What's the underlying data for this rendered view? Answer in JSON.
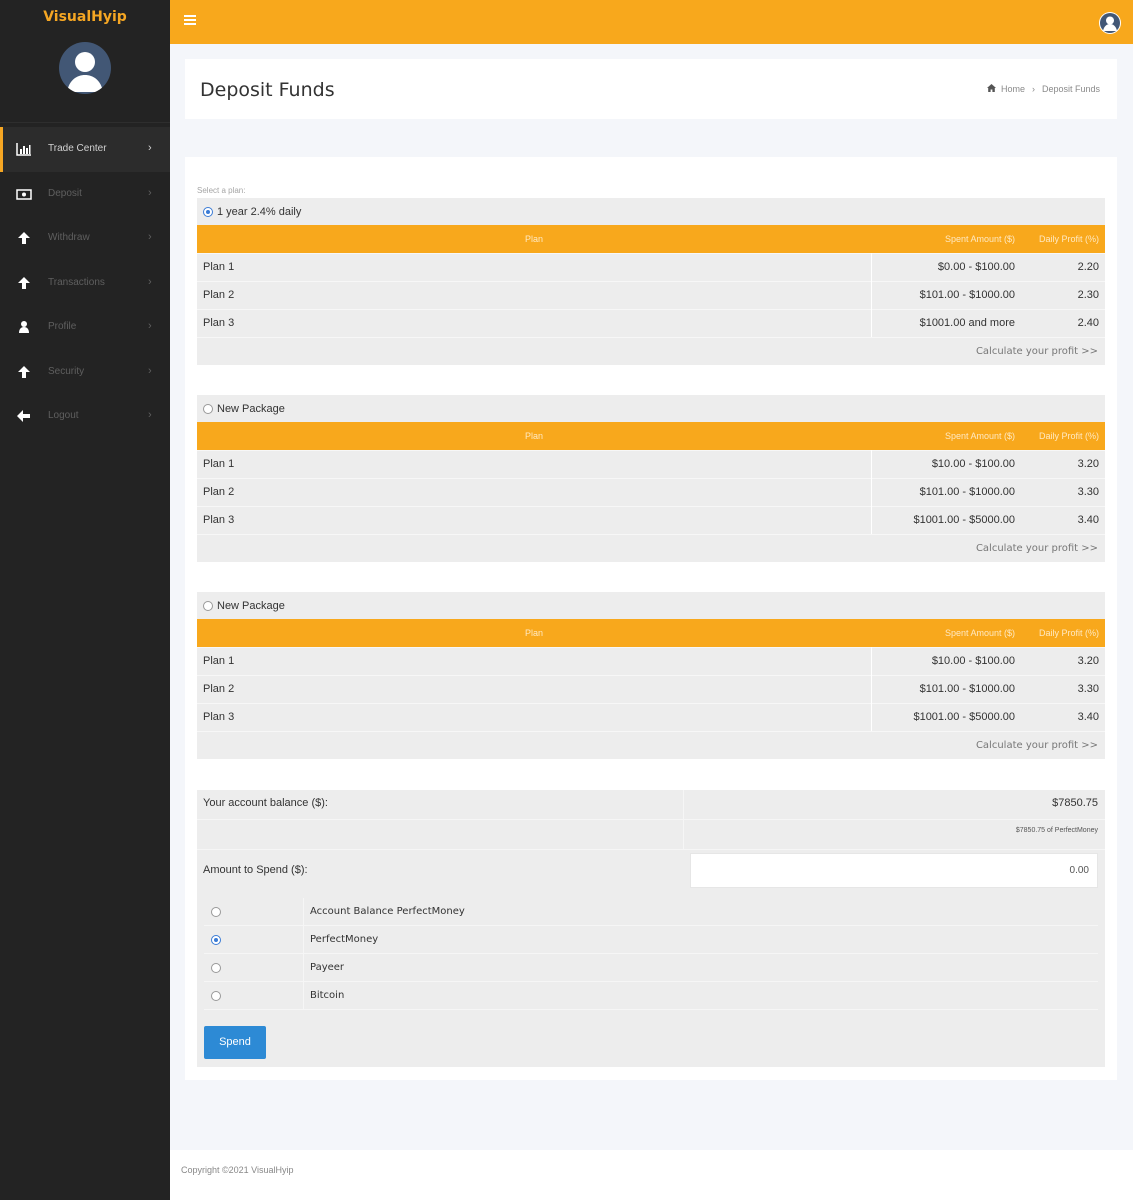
{
  "sidebar": {
    "logo": "VisualHyip",
    "items": [
      {
        "label": "Trade Center",
        "icon": "bar-chart-icon",
        "active": true
      },
      {
        "label": "Deposit",
        "icon": "money-icon"
      },
      {
        "label": "Withdraw",
        "icon": "arrow-up-icon"
      },
      {
        "label": "Transactions",
        "icon": "arrow-up-icon"
      },
      {
        "label": "Profile",
        "icon": "user-icon"
      },
      {
        "label": "Security",
        "icon": "arrow-up-icon"
      },
      {
        "label": "Logout",
        "icon": "arrow-left-icon"
      }
    ]
  },
  "header": {
    "title": "Deposit Funds",
    "breadcrumb": {
      "home": "Home",
      "current": "Deposit Funds"
    }
  },
  "form": {
    "select_label": "Select a plan:",
    "columns": {
      "plan": "Plan",
      "amount": "Spent Amount ($)",
      "profit": "Daily Profit (%)"
    },
    "calc_link": "Calculate your profit >>",
    "plans": [
      {
        "name": "1 year 2.4% daily",
        "selected": true,
        "rows": [
          {
            "plan": "Plan 1",
            "amount": "$0.00 - $100.00",
            "profit": "2.20"
          },
          {
            "plan": "Plan 2",
            "amount": "$101.00 - $1000.00",
            "profit": "2.30"
          },
          {
            "plan": "Plan 3",
            "amount": "$1001.00 and more",
            "profit": "2.40"
          }
        ]
      },
      {
        "name": "New Package",
        "selected": false,
        "rows": [
          {
            "plan": "Plan 1",
            "amount": "$10.00 - $100.00",
            "profit": "3.20"
          },
          {
            "plan": "Plan 2",
            "amount": "$101.00 - $1000.00",
            "profit": "3.30"
          },
          {
            "plan": "Plan 3",
            "amount": "$1001.00 - $5000.00",
            "profit": "3.40"
          }
        ]
      },
      {
        "name": "New Package",
        "selected": false,
        "rows": [
          {
            "plan": "Plan 1",
            "amount": "$10.00 - $100.00",
            "profit": "3.20"
          },
          {
            "plan": "Plan 2",
            "amount": "$101.00 - $1000.00",
            "profit": "3.30"
          },
          {
            "plan": "Plan 3",
            "amount": "$1001.00 - $5000.00",
            "profit": "3.40"
          }
        ]
      }
    ],
    "balance_label": "Your account balance ($):",
    "balance_value": "$7850.75",
    "balance_detail": "$7850.75 of PerfectMoney",
    "amount_label": "Amount to Spend ($):",
    "amount_value": "0.00",
    "payment_methods": [
      {
        "label": "Account Balance PerfectMoney",
        "selected": false
      },
      {
        "label": "PerfectMoney",
        "selected": true
      },
      {
        "label": "Payeer",
        "selected": false
      },
      {
        "label": "Bitcoin",
        "selected": false
      }
    ],
    "spend_label": "Spend"
  },
  "footer": {
    "copyright": "Copyright ©2021 VisualHyip"
  },
  "colors": {
    "accent": "#f8a81c",
    "sidebar": "#232323",
    "button": "#2d8ad5"
  }
}
